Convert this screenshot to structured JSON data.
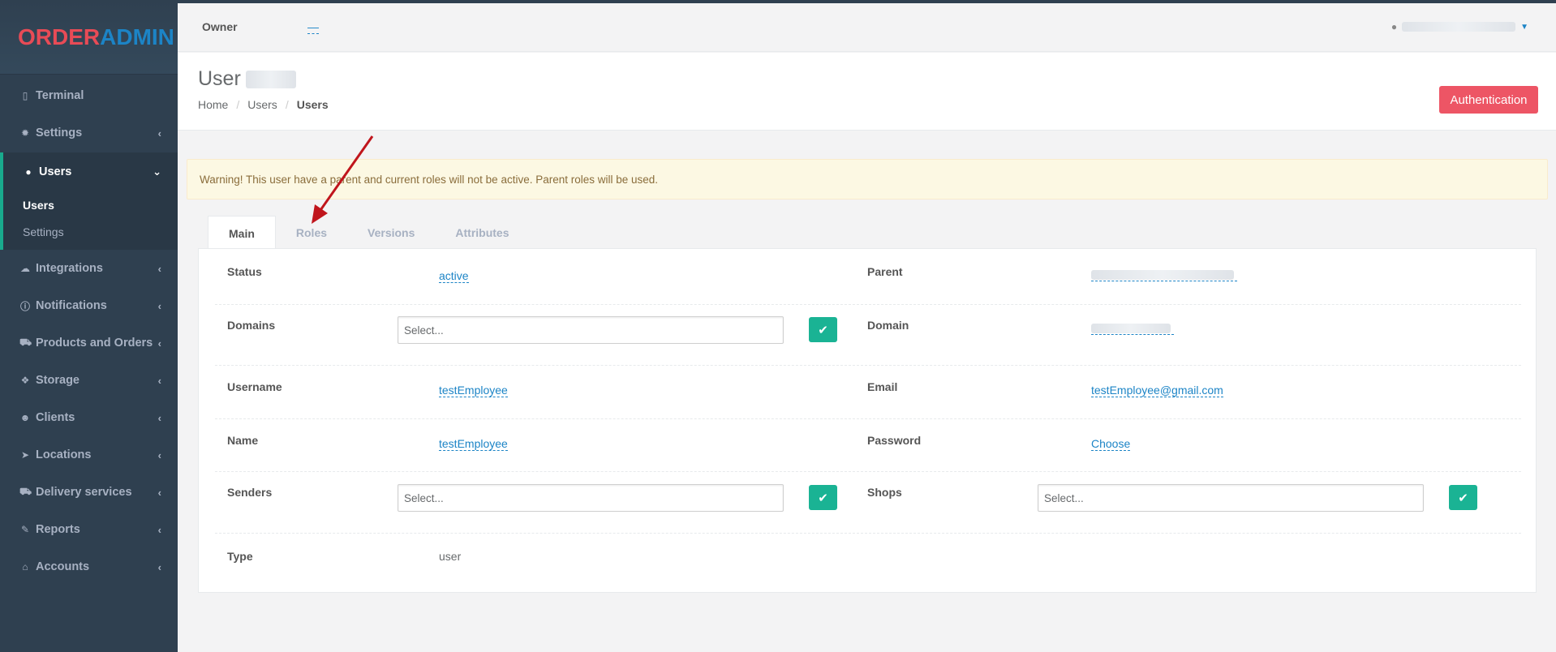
{
  "brand": {
    "part1": "ORDER",
    "part2": "ADMIN"
  },
  "sidebar": {
    "items": [
      {
        "label": "Terminal",
        "icon": "tablet-icon"
      },
      {
        "label": "Settings",
        "icon": "gear-icon"
      },
      {
        "label": "Users",
        "icon": "user-icon",
        "expanded": true,
        "children": [
          {
            "label": "Users",
            "current": true
          },
          {
            "label": "Settings"
          }
        ]
      },
      {
        "label": "Integrations",
        "icon": "cloud-icon"
      },
      {
        "label": "Notifications",
        "icon": "info-icon"
      },
      {
        "label": "Products and Orders",
        "icon": "cart-icon"
      },
      {
        "label": "Storage",
        "icon": "cubes-icon"
      },
      {
        "label": "Clients",
        "icon": "users-icon"
      },
      {
        "label": "Locations",
        "icon": "location-arrow-icon"
      },
      {
        "label": "Delivery services",
        "icon": "truck-icon"
      },
      {
        "label": "Reports",
        "icon": "wrench-icon"
      },
      {
        "label": "Accounts",
        "icon": "bank-icon"
      }
    ]
  },
  "topbar": {
    "owner_label": "Owner",
    "owner_value": "—"
  },
  "heading": {
    "title": "User",
    "breadcrumb": [
      "Home",
      "Users",
      "Users"
    ],
    "auth_button": "Authentication"
  },
  "warning": "Warning! This user have a parent and current roles will not be active. Parent roles will be used.",
  "tabs": [
    "Main",
    "Roles",
    "Versions",
    "Attributes"
  ],
  "fields": {
    "status": {
      "label": "Status",
      "value": "active"
    },
    "parent": {
      "label": "Parent"
    },
    "domains": {
      "label": "Domains",
      "placeholder": "Select..."
    },
    "domain": {
      "label": "Domain"
    },
    "username": {
      "label": "Username",
      "value": "testEmployee"
    },
    "email": {
      "label": "Email",
      "value": "testEmployee@gmail.com"
    },
    "name": {
      "label": "Name",
      "value": "testEmployee"
    },
    "password": {
      "label": "Password",
      "value": "Choose"
    },
    "senders": {
      "label": "Senders",
      "placeholder": "Select..."
    },
    "shops": {
      "label": "Shops",
      "placeholder": "Select..."
    },
    "type": {
      "label": "Type",
      "value": "user"
    }
  },
  "colors": {
    "sidebar": "#2f4050",
    "accent": "#19aa8d",
    "link": "#1c84c6",
    "danger": "#ed5565",
    "success": "#1ab394",
    "arrow": "#c0151c"
  }
}
